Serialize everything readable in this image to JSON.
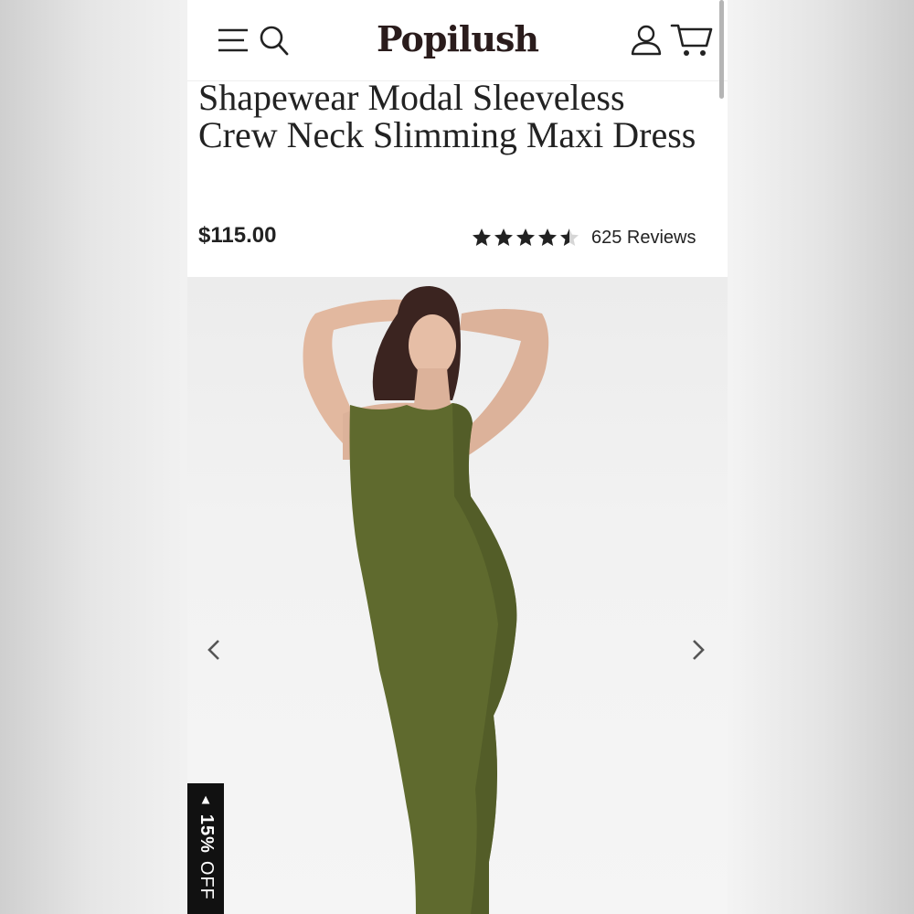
{
  "header": {
    "brand": "Popilush",
    "icons": [
      "menu-icon",
      "search-icon",
      "account-icon",
      "cart-icon"
    ]
  },
  "product": {
    "title": "Shapewear Modal Sleeveless Crew Neck Slimming Maxi Dress",
    "price": "$115.00",
    "rating": 4.5,
    "reviews_label": "625 Reviews",
    "dress_color": "#5f6a2e"
  },
  "gallery": {
    "prev_icon": "chevron-left-icon",
    "next_icon": "chevron-right-icon"
  },
  "promo": {
    "icon": "play-triangle-icon",
    "percent": "15%",
    "off": "OFF"
  }
}
